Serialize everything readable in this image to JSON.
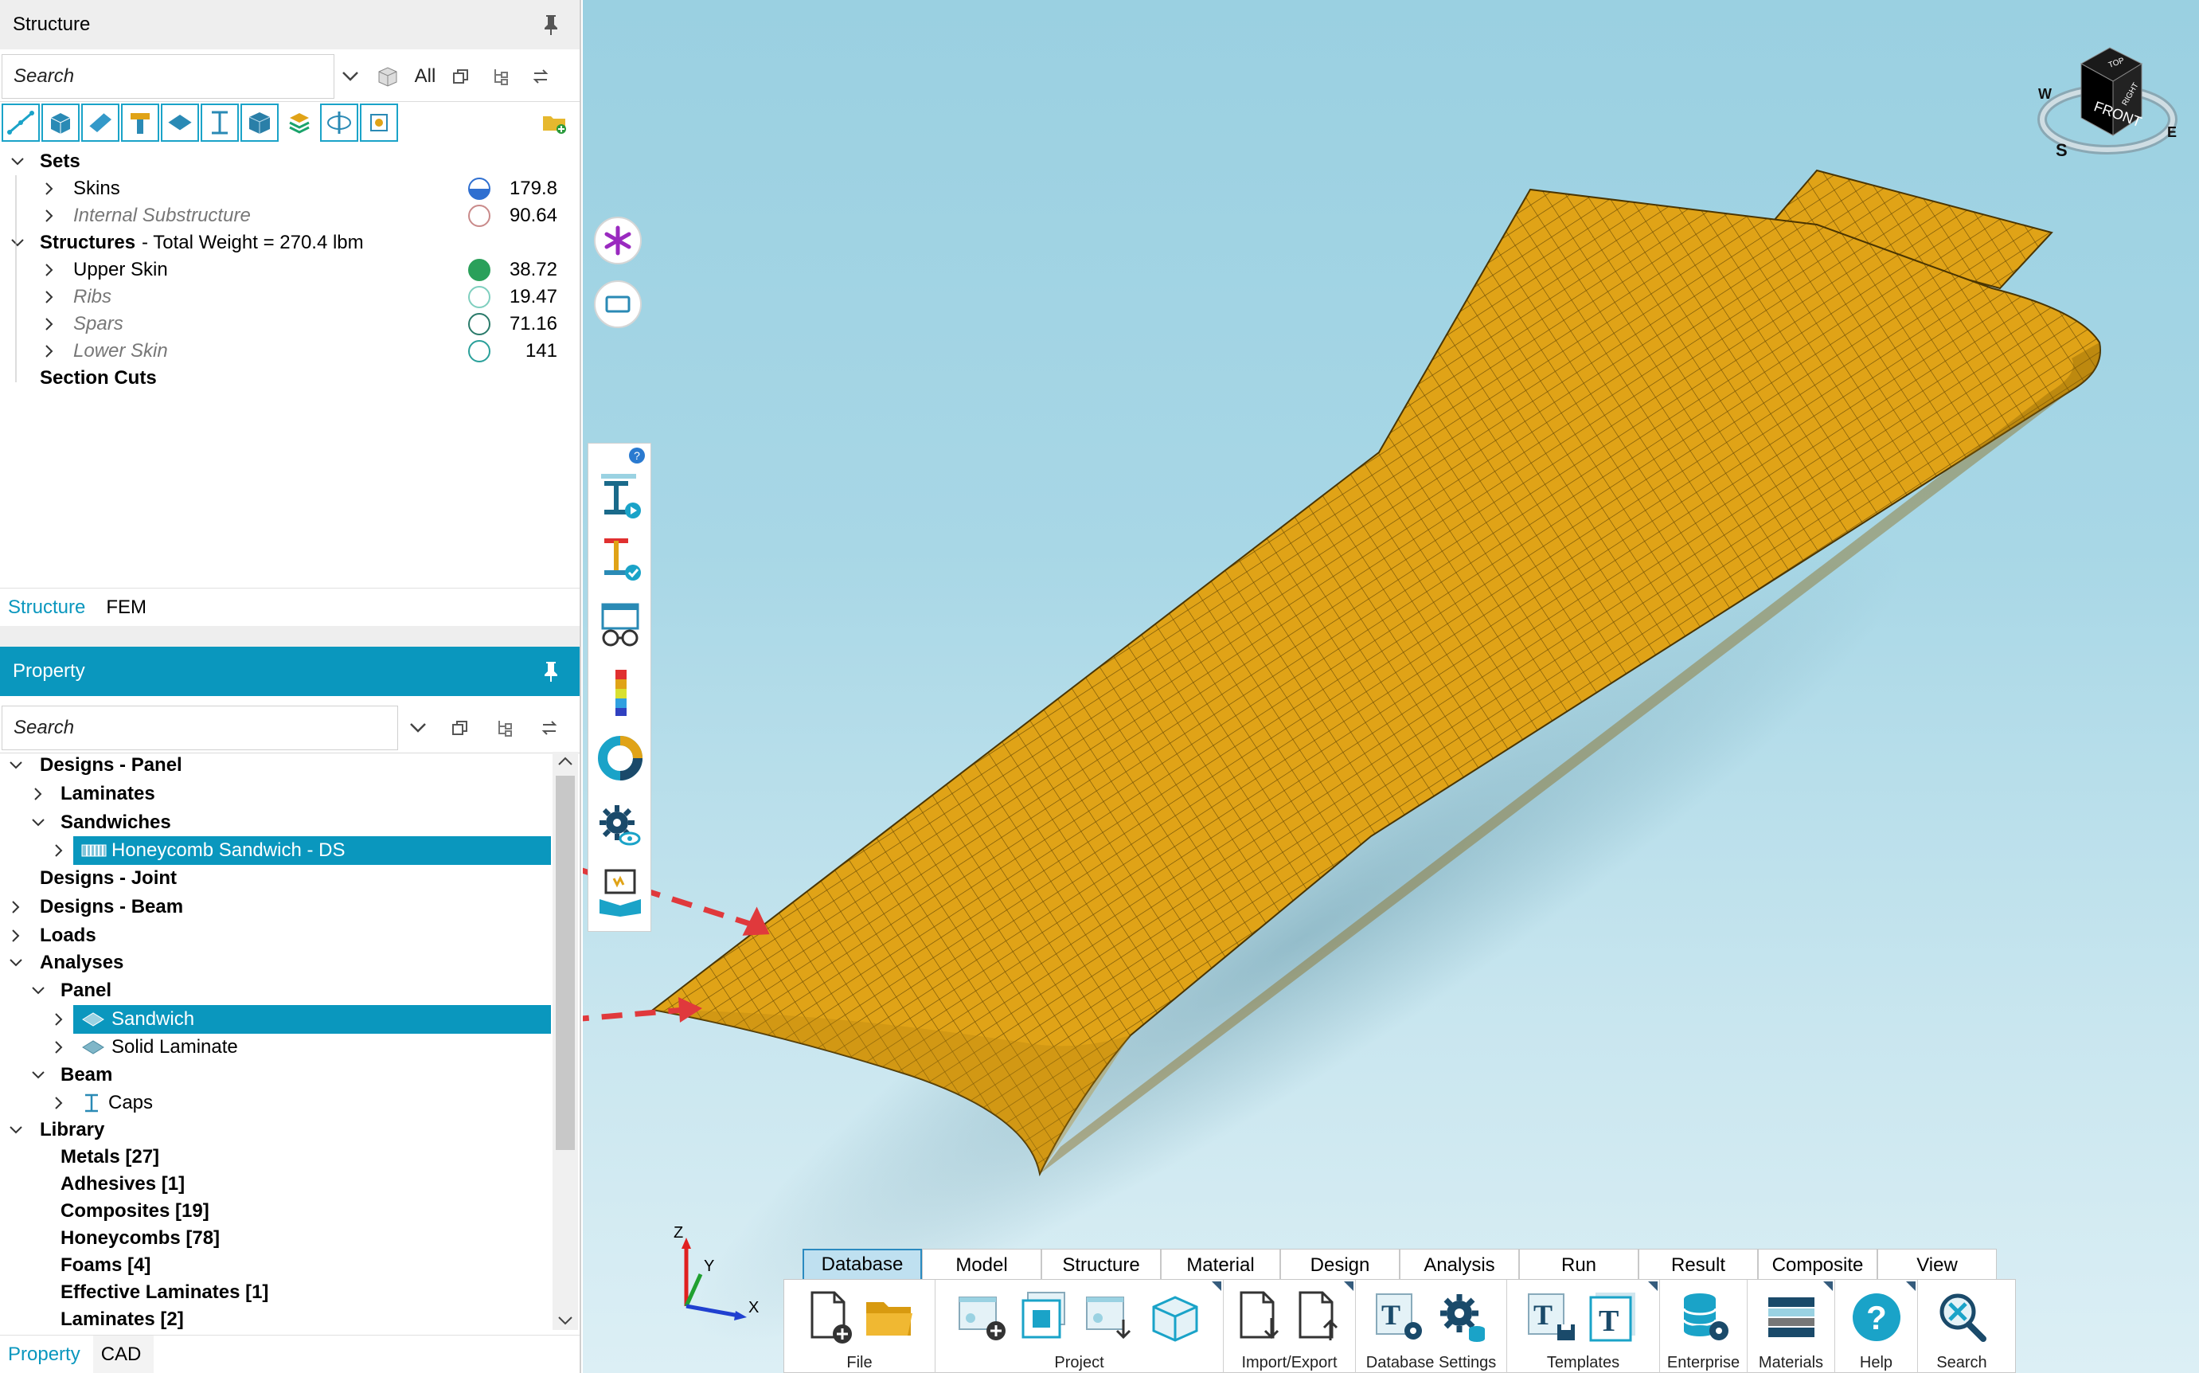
{
  "structure_panel": {
    "title": "Structure",
    "search_placeholder": "Search",
    "filter_all": "All",
    "tree": {
      "sets": "Sets",
      "skins": "Skins",
      "skins_value": "179.8",
      "internal_substructure": "Internal Substructure",
      "internal_substructure_value": "90.64",
      "structures": "Structures",
      "total_weight": "- Total Weight = 270.4 lbm",
      "upper_skin": "Upper Skin",
      "upper_skin_value": "38.72",
      "ribs": "Ribs",
      "ribs_value": "19.47",
      "spars": "Spars",
      "spars_value": "71.16",
      "lower_skin": "Lower Skin",
      "lower_skin_value": "141",
      "section_cuts": "Section Cuts"
    },
    "tabs": {
      "structure": "Structure",
      "fem": "FEM"
    }
  },
  "property_panel": {
    "title": "Property",
    "search_placeholder": "Search",
    "tree": {
      "designs_panel": "Designs - Panel",
      "laminates": "Laminates",
      "sandwiches": "Sandwiches",
      "honeycomb_sandwich": "Honeycomb Sandwich - DS",
      "designs_joint": "Designs - Joint",
      "designs_beam": "Designs - Beam",
      "loads": "Loads",
      "analyses": "Analyses",
      "panel": "Panel",
      "sandwich": "Sandwich",
      "solid_laminate": "Solid Laminate",
      "beam": "Beam",
      "caps": "Caps",
      "library": "Library",
      "metals": "Metals [27]",
      "adhesives": "Adhesives [1]",
      "composites": "Composites [19]",
      "honeycombs": "Honeycombs [78]",
      "foams": "Foams [4]",
      "effective_laminates": "Effective Laminates [1]",
      "laminates_lib": "Laminates [2]"
    },
    "tabs": {
      "property": "Property",
      "cad": "CAD"
    }
  },
  "ribbon": {
    "tabs": [
      "Database",
      "Model",
      "Structure",
      "Material",
      "Design",
      "Analysis",
      "Run",
      "Result",
      "Composite",
      "View"
    ],
    "groups": {
      "file": "File",
      "project": "Project",
      "import_export": "Import/Export",
      "database_settings": "Database Settings",
      "templates": "Templates",
      "enterprise": "Enterprise",
      "materials": "Materials",
      "help": "Help",
      "search": "Search"
    }
  },
  "view": {
    "axis_x": "X",
    "axis_y": "Y",
    "axis_z": "Z",
    "cube_front": "FRONT",
    "cube_top": "TOP",
    "cube_right": "RIGHT",
    "compass_w": "W",
    "compass_s": "S",
    "compass_e": "E",
    "colors": {
      "wing": "#e0a317",
      "accent": "#0a97be",
      "arrow": "#e0393c"
    }
  }
}
